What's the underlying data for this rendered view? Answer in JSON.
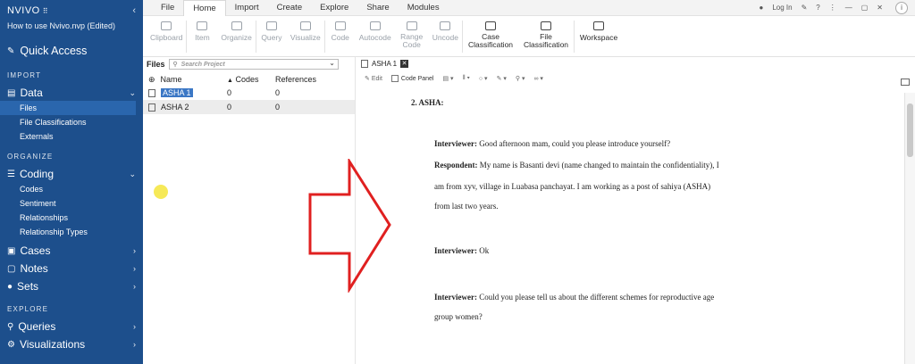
{
  "sidebar": {
    "logo": "NVIVO",
    "project": "How to use Nvivo.nvp (Edited)",
    "quick_access": "Quick Access",
    "sections": {
      "import": "IMPORT",
      "organize": "ORGANIZE",
      "explore": "EXPLORE"
    },
    "data_label": "Data",
    "data_items": [
      "Files",
      "File Classifications",
      "Externals"
    ],
    "coding_label": "Coding",
    "coding_items": [
      "Codes",
      "Sentiment",
      "Relationships",
      "Relationship Types"
    ],
    "cases_label": "Cases",
    "notes_label": "Notes",
    "sets_label": "Sets",
    "queries_label": "Queries",
    "visualizations_label": "Visualizations"
  },
  "menubar": {
    "items": [
      "File",
      "Home",
      "Import",
      "Create",
      "Explore",
      "Share",
      "Modules"
    ],
    "login": "Log In"
  },
  "ribbon": {
    "buttons": [
      {
        "label": "Clipboard"
      },
      {
        "label": "Item"
      },
      {
        "label": "Organize"
      },
      {
        "label": "Query"
      },
      {
        "label": "Visualize"
      },
      {
        "label": "Code"
      },
      {
        "label": "Autocode"
      },
      {
        "label": "Range Code"
      },
      {
        "label": "Uncode"
      },
      {
        "label": "Case Classification"
      },
      {
        "label": "File Classification"
      },
      {
        "label": "Workspace"
      }
    ]
  },
  "files_pane": {
    "title": "Files",
    "search_placeholder": "Search Project",
    "columns": [
      "Name",
      "Codes",
      "References"
    ],
    "rows": [
      {
        "name": "ASHA 1",
        "codes": "0",
        "refs": "0"
      },
      {
        "name": "ASHA 2",
        "codes": "0",
        "refs": "0"
      }
    ]
  },
  "doc_pane": {
    "tab_label": "ASHA 1",
    "edit_label": "Edit",
    "code_panel_label": "Code Panel",
    "heading": "2. ASHA:",
    "lines": [
      {
        "speaker": "Interviewer:",
        "text": " Good afternoon mam, could you please introduce yourself?"
      },
      {
        "speaker": "Respondent:",
        "text": " My name is Basanti devi (name changed to maintain the confidentiality), I"
      },
      {
        "speaker": "",
        "text": "am from xyv, village in Luabasa panchayat. I am working as a post of sahiya (ASHA)"
      },
      {
        "speaker": "",
        "text": "from last two years."
      },
      {
        "speaker": "Interviewer:",
        "text": " Ok"
      },
      {
        "speaker": "Interviewer:",
        "text": " Could you please tell us about the different schemes for reproductive age"
      },
      {
        "speaker": "",
        "text": "group women?"
      }
    ]
  },
  "colors": {
    "sidebar_bg": "#1d4f8c",
    "selected_bg": "#3b77c5",
    "arrow_red": "#e02020",
    "cursor_yellow": "#f5e53b"
  }
}
